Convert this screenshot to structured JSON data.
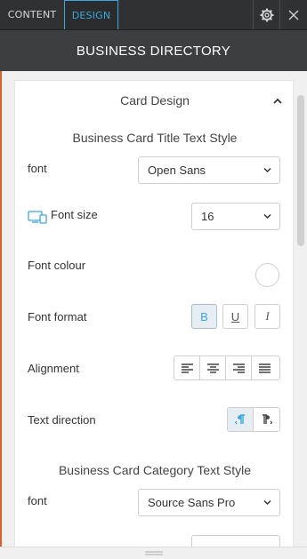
{
  "tabs": {
    "content": "CONTENT",
    "design": "DESIGN"
  },
  "header": {
    "title": "BUSINESS DIRECTORY"
  },
  "section": {
    "title": "Card Design"
  },
  "title_style": {
    "heading": "Business Card Title Text Style",
    "font_label": "font",
    "font_value": "Open Sans",
    "size_label": "Font size",
    "size_value": "16",
    "colour_label": "Font colour",
    "colour_value": "#ffffff",
    "format_label": "Font format",
    "format_bold": "B",
    "format_underline": "U",
    "format_italic": "I",
    "alignment_label": "Alignment",
    "direction_label": "Text direction"
  },
  "category_style": {
    "heading": "Business Card Category Text Style",
    "font_label": "font",
    "font_value": "Source Sans Pro"
  },
  "colors": {
    "accent": "#3aa8df",
    "brand_edge": "#d9622b"
  }
}
